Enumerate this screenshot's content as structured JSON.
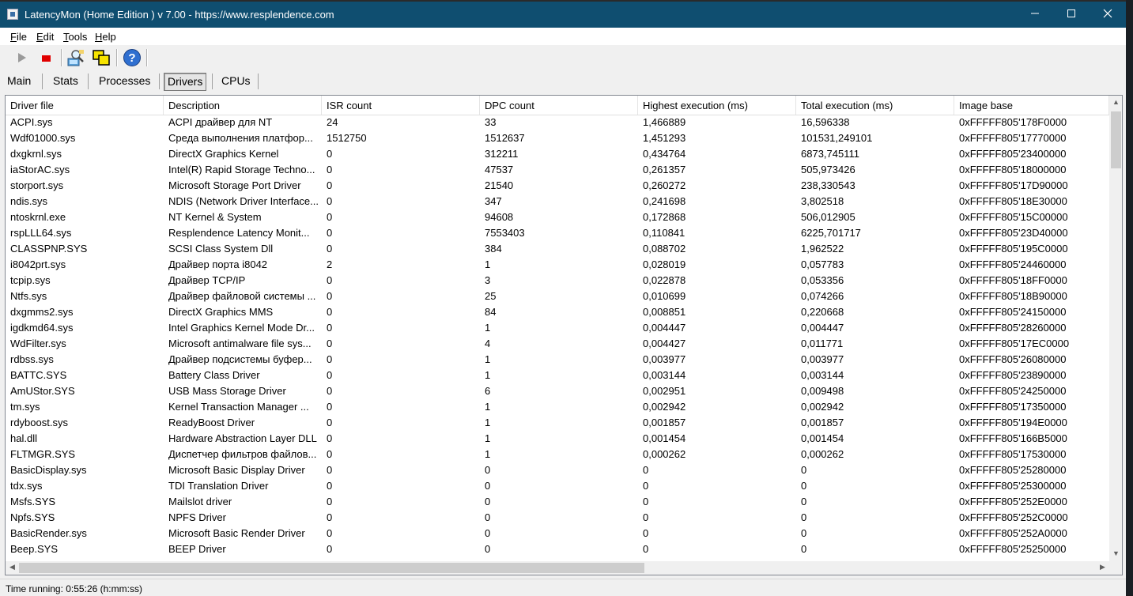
{
  "window": {
    "title": "LatencyMon  (Home Edition )  v 7.00 - https://www.resplendence.com"
  },
  "menu": [
    {
      "label": "File",
      "accel": "F",
      "rest": "ile"
    },
    {
      "label": "Edit",
      "accel": "E",
      "rest": "dit"
    },
    {
      "label": "Tools",
      "accel": "T",
      "rest": "ools"
    },
    {
      "label": "Help",
      "accel": "H",
      "rest": "elp"
    }
  ],
  "tabs": [
    {
      "label": "Main",
      "active": false
    },
    {
      "label": "Stats",
      "active": false
    },
    {
      "label": "Processes",
      "active": false
    },
    {
      "label": "Drivers",
      "active": true
    },
    {
      "label": "CPUs",
      "active": false
    }
  ],
  "table": {
    "columns": [
      "Driver file",
      "Description",
      "ISR count",
      "DPC count",
      "Highest execution (ms)",
      "Total execution (ms)",
      "Image base"
    ],
    "rows": [
      [
        "ACPI.sys",
        "ACPI драйвер для NT",
        "24",
        "33",
        "1,466889",
        "16,596338",
        "0xFFFFF805'178F0000"
      ],
      [
        "Wdf01000.sys",
        "Среда выполнения платфор...",
        "1512750",
        "1512637",
        "1,451293",
        "101531,249101",
        "0xFFFFF805'17770000"
      ],
      [
        "dxgkrnl.sys",
        "DirectX Graphics Kernel",
        "0",
        "312211",
        "0,434764",
        "6873,745111",
        "0xFFFFF805'23400000"
      ],
      [
        "iaStorAC.sys",
        "Intel(R) Rapid Storage Techno...",
        "0",
        "47537",
        "0,261357",
        "505,973426",
        "0xFFFFF805'18000000"
      ],
      [
        "storport.sys",
        "Microsoft Storage Port Driver",
        "0",
        "21540",
        "0,260272",
        "238,330543",
        "0xFFFFF805'17D90000"
      ],
      [
        "ndis.sys",
        "NDIS (Network Driver Interface...",
        "0",
        "347",
        "0,241698",
        "3,802518",
        "0xFFFFF805'18E30000"
      ],
      [
        "ntoskrnl.exe",
        "NT Kernel & System",
        "0",
        "94608",
        "0,172868",
        "506,012905",
        "0xFFFFF805'15C00000"
      ],
      [
        "rspLLL64.sys",
        "Resplendence Latency Monit...",
        "0",
        "7553403",
        "0,110841",
        "6225,701717",
        "0xFFFFF805'23D40000"
      ],
      [
        "CLASSPNP.SYS",
        "SCSI Class System Dll",
        "0",
        "384",
        "0,088702",
        "1,962522",
        "0xFFFFF805'195C0000"
      ],
      [
        "i8042prt.sys",
        "Драйвер порта i8042",
        "2",
        "1",
        "0,028019",
        "0,057783",
        "0xFFFFF805'24460000"
      ],
      [
        "tcpip.sys",
        "Драйвер TCP/IP",
        "0",
        "3",
        "0,022878",
        "0,053356",
        "0xFFFFF805'18FF0000"
      ],
      [
        "Ntfs.sys",
        "Драйвер файловой системы ...",
        "0",
        "25",
        "0,010699",
        "0,074266",
        "0xFFFFF805'18B90000"
      ],
      [
        "dxgmms2.sys",
        "DirectX Graphics MMS",
        "0",
        "84",
        "0,008851",
        "0,220668",
        "0xFFFFF805'24150000"
      ],
      [
        "igdkmd64.sys",
        "Intel Graphics Kernel Mode Dr...",
        "0",
        "1",
        "0,004447",
        "0,004447",
        "0xFFFFF805'28260000"
      ],
      [
        "WdFilter.sys",
        "Microsoft antimalware file sys...",
        "0",
        "4",
        "0,004427",
        "0,011771",
        "0xFFFFF805'17EC0000"
      ],
      [
        "rdbss.sys",
        "Драйвер подсистемы буфер...",
        "0",
        "1",
        "0,003977",
        "0,003977",
        "0xFFFFF805'26080000"
      ],
      [
        "BATTC.SYS",
        "Battery Class Driver",
        "0",
        "1",
        "0,003144",
        "0,003144",
        "0xFFFFF805'23890000"
      ],
      [
        "AmUStor.SYS",
        "USB Mass Storage Driver",
        "0",
        "6",
        "0,002951",
        "0,009498",
        "0xFFFFF805'24250000"
      ],
      [
        "tm.sys",
        "Kernel Transaction Manager ...",
        "0",
        "1",
        "0,002942",
        "0,002942",
        "0xFFFFF805'17350000"
      ],
      [
        "rdyboost.sys",
        "ReadyBoost Driver",
        "0",
        "1",
        "0,001857",
        "0,001857",
        "0xFFFFF805'194E0000"
      ],
      [
        "hal.dll",
        "Hardware Abstraction Layer DLL",
        "0",
        "1",
        "0,001454",
        "0,001454",
        "0xFFFFF805'166B5000"
      ],
      [
        "FLTMGR.SYS",
        "Диспетчер фильтров файлов...",
        "0",
        "1",
        "0,000262",
        "0,000262",
        "0xFFFFF805'17530000"
      ],
      [
        "BasicDisplay.sys",
        "Microsoft Basic Display Driver",
        "0",
        "0",
        "0",
        "0",
        "0xFFFFF805'25280000"
      ],
      [
        "tdx.sys",
        "TDI Translation Driver",
        "0",
        "0",
        "0",
        "0",
        "0xFFFFF805'25300000"
      ],
      [
        "Msfs.SYS",
        "Mailslot driver",
        "0",
        "0",
        "0",
        "0",
        "0xFFFFF805'252E0000"
      ],
      [
        "Npfs.SYS",
        "NPFS Driver",
        "0",
        "0",
        "0",
        "0",
        "0xFFFFF805'252C0000"
      ],
      [
        "BasicRender.sys",
        "Microsoft Basic Render Driver",
        "0",
        "0",
        "0",
        "0",
        "0xFFFFF805'252A0000"
      ],
      [
        "Beep.SYS",
        "BEEP Driver",
        "0",
        "0",
        "0",
        "0",
        "0xFFFFF805'25250000"
      ]
    ]
  },
  "status": {
    "text": "Time running: 0:55:26  (h:mm:ss)"
  }
}
